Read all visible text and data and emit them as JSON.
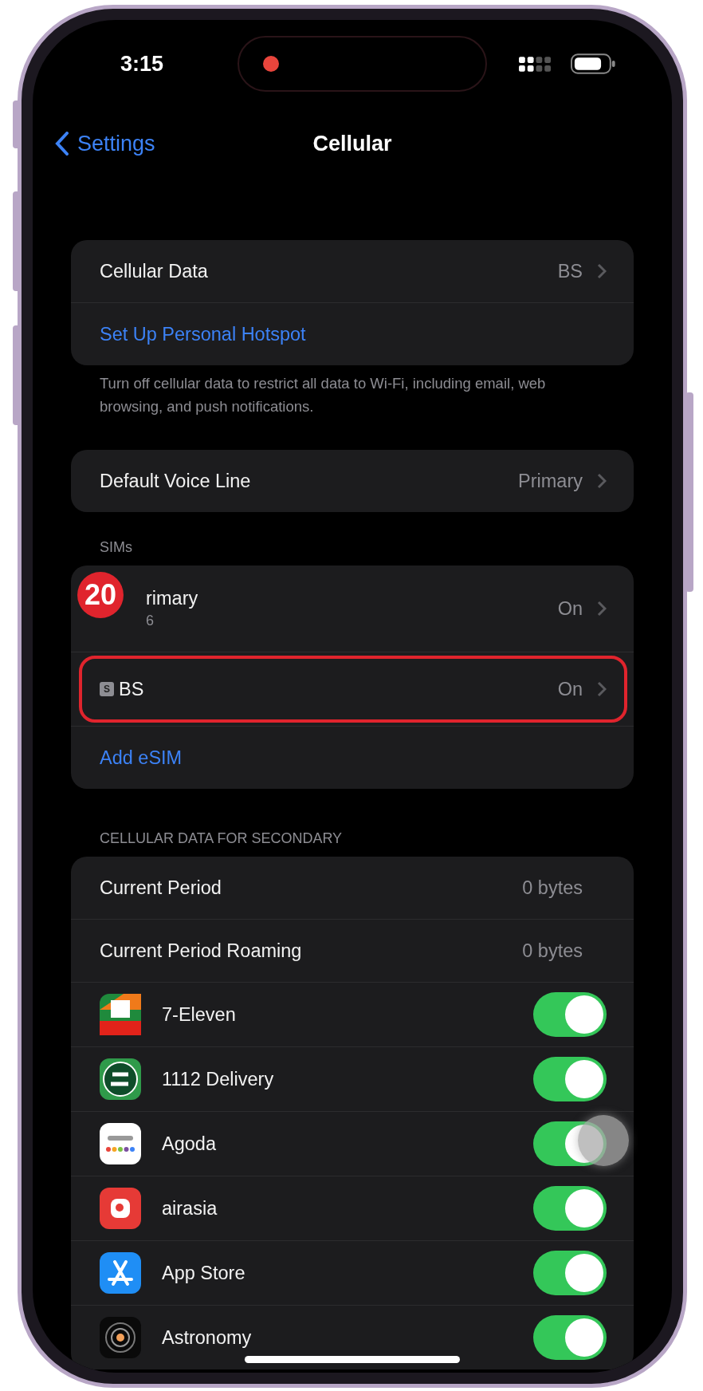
{
  "status_bar": {
    "time": "3:15",
    "recording": true
  },
  "nav": {
    "back": "Settings",
    "title": "Cellular"
  },
  "sections": [
    {
      "rows": [
        {
          "kind": "value",
          "label": "Cellular Data",
          "value": "BS"
        },
        {
          "kind": "link",
          "label": "Set Up Personal Hotspot"
        }
      ],
      "footer": "Turn off cellular data to restrict all data to Wi-Fi, including email, web browsing, and push notifications."
    },
    {
      "rows": [
        {
          "kind": "value",
          "label": "Default Voice Line",
          "value": "Primary"
        }
      ]
    },
    {
      "header": "SIMs",
      "rows": [
        {
          "kind": "sim",
          "label": "rimary",
          "subtitle": "6",
          "value": "On",
          "step_badge": "20",
          "highlighted": false
        },
        {
          "kind": "sim",
          "label": "BS",
          "value": "On",
          "sim_icon": "S",
          "highlighted": true
        },
        {
          "kind": "link",
          "label": "Add eSIM"
        }
      ]
    },
    {
      "header": "CELLULAR DATA FOR SECONDARY",
      "rows": [
        {
          "kind": "usage",
          "label": "Current Period",
          "value": "0 bytes"
        },
        {
          "kind": "usage",
          "label": "Current Period Roaming",
          "value": "0 bytes"
        },
        {
          "kind": "app",
          "label": "7-Eleven",
          "on": true,
          "touched": false
        },
        {
          "kind": "app",
          "label": "1112 Delivery",
          "on": true,
          "touched": false
        },
        {
          "kind": "app",
          "label": "Agoda",
          "on": true,
          "touched": true
        },
        {
          "kind": "app",
          "label": "airasia",
          "on": true,
          "touched": false
        },
        {
          "kind": "app",
          "label": "App Store",
          "on": true,
          "touched": false
        },
        {
          "kind": "app",
          "label": "Astronomy",
          "on": true,
          "touched": false
        }
      ]
    }
  ]
}
